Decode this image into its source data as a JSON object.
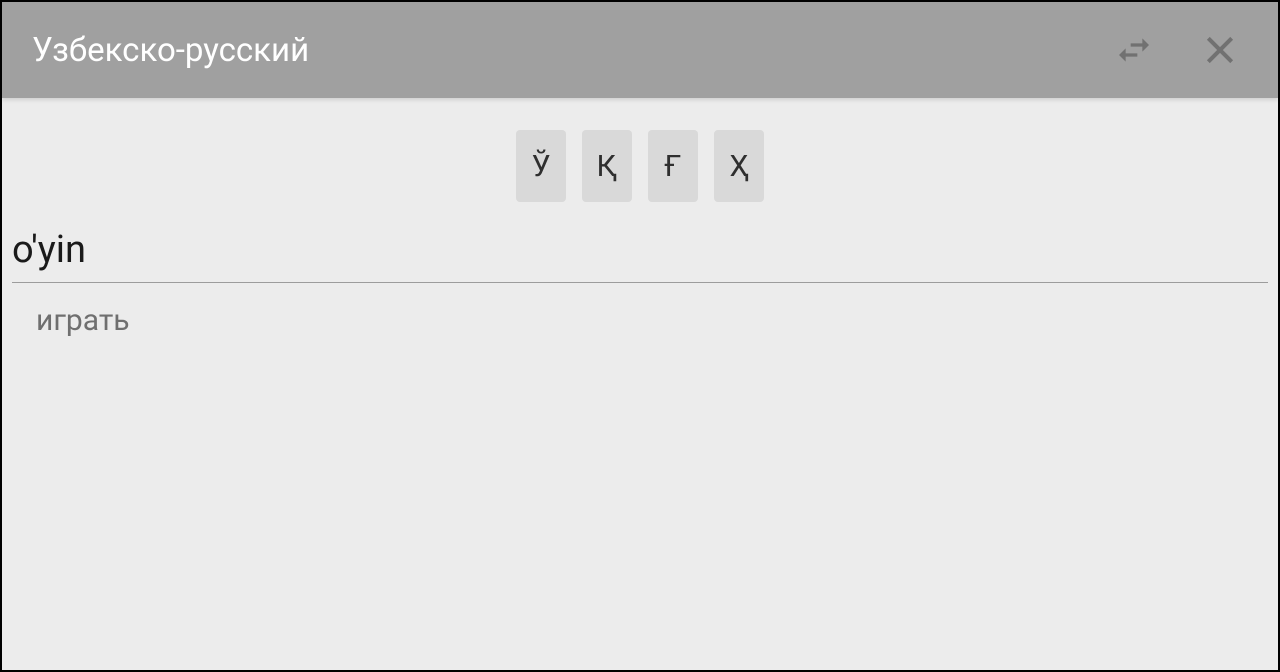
{
  "header": {
    "title": "Узбекско-русский"
  },
  "special_chars": [
    "Ў",
    "Қ",
    "Ғ",
    "Ҳ"
  ],
  "input": {
    "value": "o'yin"
  },
  "results": [
    "играть"
  ]
}
